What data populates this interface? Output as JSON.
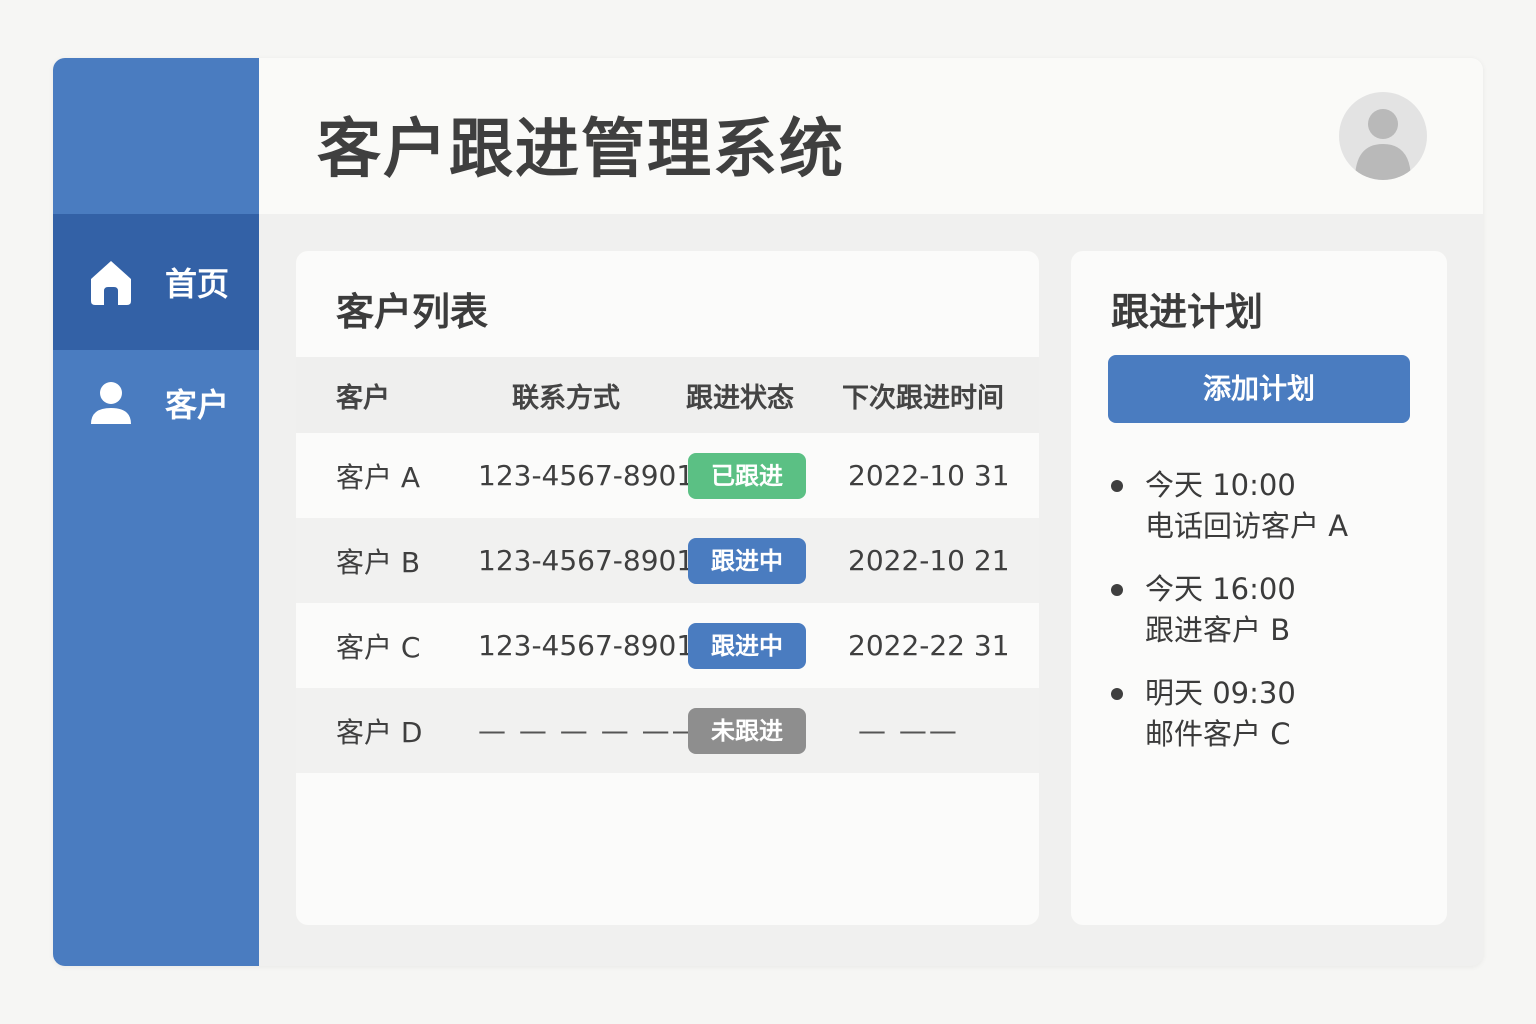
{
  "app": {
    "title": "客户跟进管理系统"
  },
  "sidebar": {
    "items": [
      {
        "label": "首页",
        "icon": "home-icon",
        "active": true
      },
      {
        "label": "客户",
        "icon": "user-icon",
        "active": false
      }
    ]
  },
  "customer_list": {
    "title": "客户列表",
    "columns": [
      "客户",
      "联系方式",
      "跟进状态",
      "下次跟进时间"
    ],
    "rows": [
      {
        "name": "客户 A",
        "phone": "123-4567-8901",
        "status": "已跟进",
        "status_color": "#5bc084",
        "next": "2022-10 31"
      },
      {
        "name": "客户 B",
        "phone": "123-4567-8901",
        "status": "跟进中",
        "status_color": "#4a7cc0",
        "next": "2022-10 21"
      },
      {
        "name": "客户 C",
        "phone": "123-4567-8901",
        "status": "跟进中",
        "status_color": "#4a7cc0",
        "next": "2022-22 31"
      },
      {
        "name": "客户 D",
        "phone": "— — — — ——",
        "status": "未跟进",
        "status_color": "#8e8e8e",
        "next": "— ——"
      }
    ]
  },
  "plan": {
    "title": "跟进计划",
    "add_button": "添加计划",
    "items": [
      {
        "time": "今天 10:00",
        "task": "电话回访客户 A"
      },
      {
        "time": "今天 16:00",
        "task": "跟进客户 B"
      },
      {
        "time": "明天 09:30",
        "task": "邮件客户 C"
      }
    ]
  },
  "colors": {
    "sidebar": "#4a7cc0",
    "sidebar_active": "#3361a6",
    "accent": "#4a7cc0"
  }
}
